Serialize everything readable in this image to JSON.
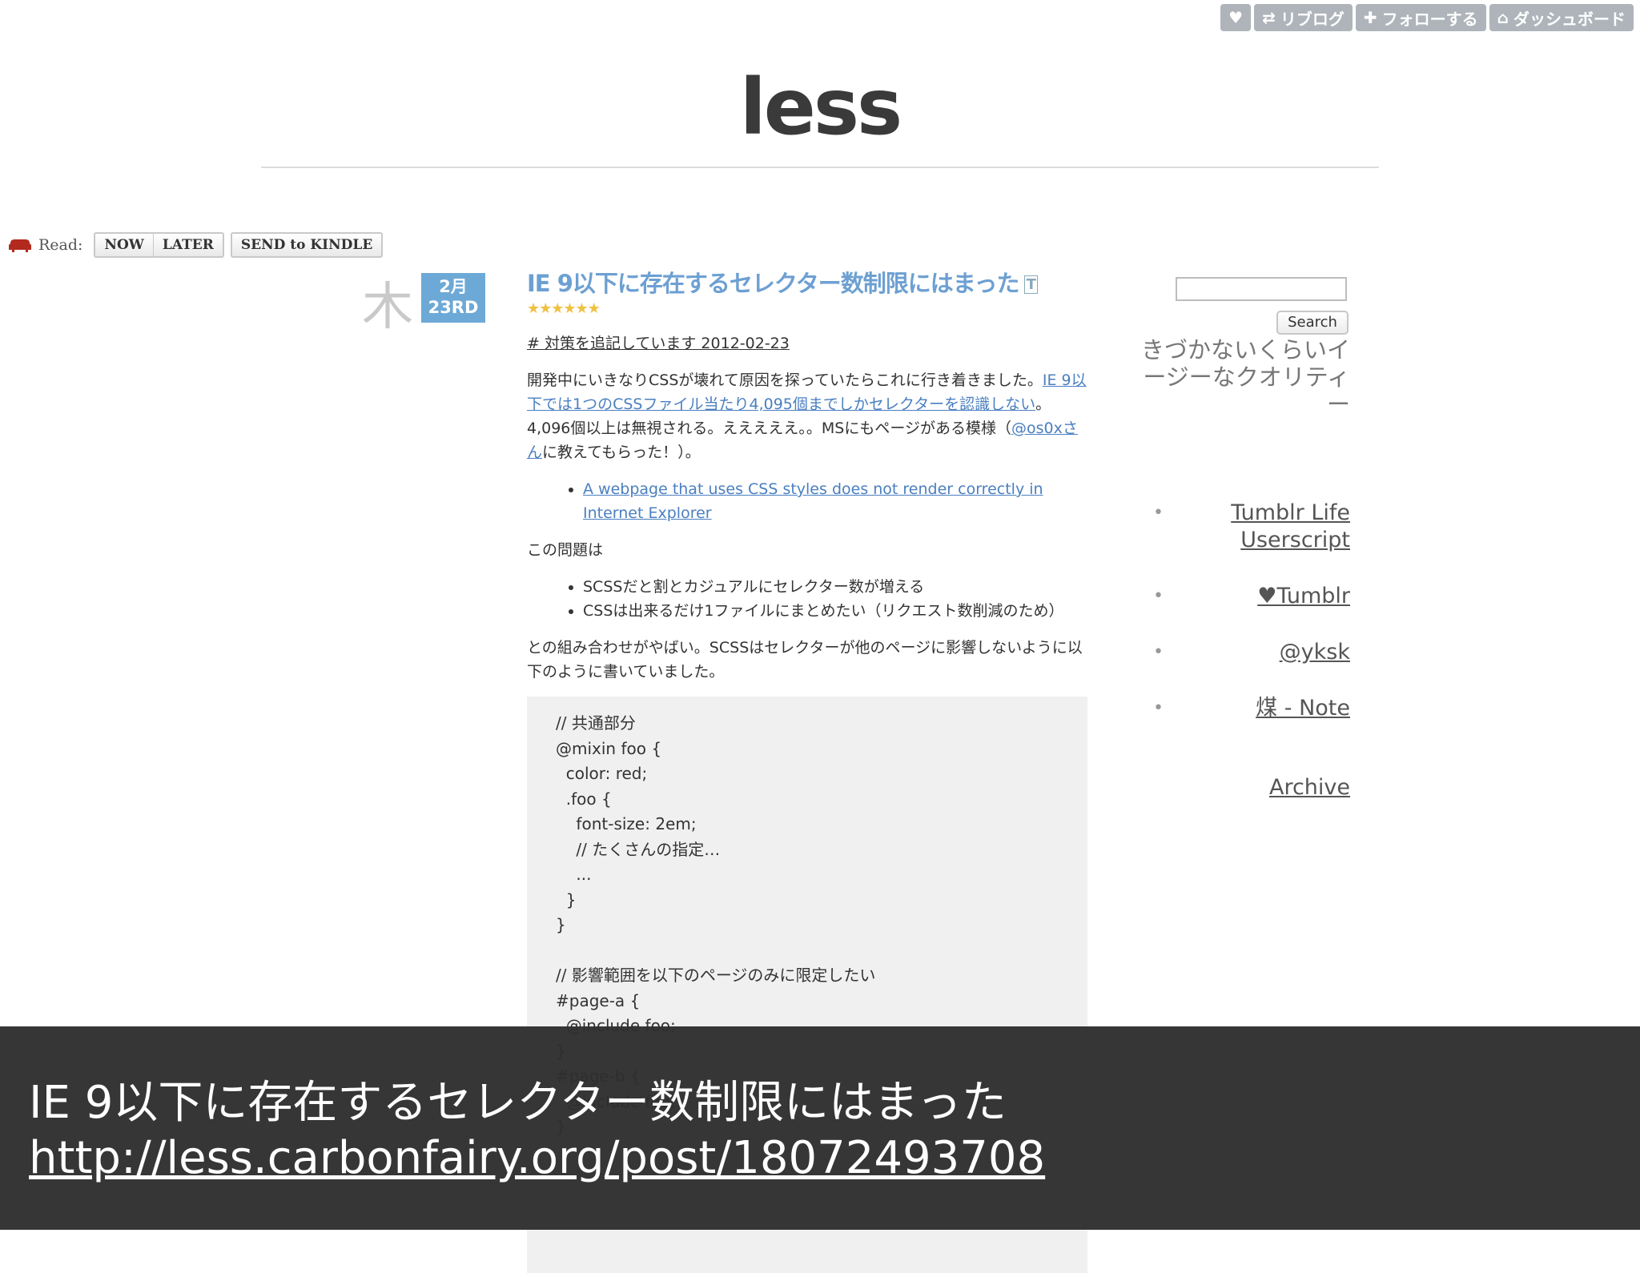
{
  "tumblr_controls": {
    "reblog": "リブログ",
    "follow": "フォローする",
    "dashboard": "ダッシュボード"
  },
  "blog": {
    "title": "less"
  },
  "read_bar": {
    "label": "Read:",
    "now": "NOW",
    "later": "LATER",
    "send_to_kindle": "SEND to KINDLE"
  },
  "post": {
    "day_of_week": "木",
    "month": "2月",
    "day": "23RD",
    "title": "IE 9以下に存在するセレクター数制限にはまった",
    "stars": "★★★★★★",
    "note_link": "# 対策を追記しています 2012-02-23",
    "p1_before": "開発中にいきなりCSSが壊れて原因を探っていたらこれに行き着きました。",
    "p1_link": "IE 9以下では1つのCSSファイル当たり4,095個までしかセレクターを認識しない",
    "p1_middle": "。4,096個以上は無視される。えええええ。。MSにもページがある模様（",
    "p1_user_link": "@os0xさん",
    "p1_after": "に教えてもらった！）。",
    "ms_link": "A webpage that uses CSS styles does not render correctly in Internet Explorer",
    "p2": "この問題は",
    "li1": "SCSSだと割とカジュアルにセレクター数が増える",
    "li2": "CSSは出来るだけ1ファイルにまとめたい（リクエスト数削減のため）",
    "p3": "との組み合わせがやばい。SCSSはセレクターが他のページに影響しないように以下のように書いていました。",
    "code": "// 共通部分\n@mixin foo {\n  color: red;\n  .foo {\n    font-size: 2em;\n    // たくさんの指定…\n    ...\n  }\n}\n\n// 影響範囲を以下のページのみに限定したい\n#page-a {\n  @include foo;\n}\n#page-b {\n  @include foo;\n}"
  },
  "sidebar": {
    "search_button": "Search",
    "description": "きづかないくらいイージーなクオリティー",
    "links": [
      "Tumblr Life Userscript",
      "♥Tumblr",
      "@yksk",
      "煤 - Note"
    ],
    "archive": "Archive"
  },
  "overlay": {
    "title": "IE 9以下に存在するセレクター数制限にはまった",
    "url": "http://less.carbonfairy.org/post/18072493708"
  }
}
